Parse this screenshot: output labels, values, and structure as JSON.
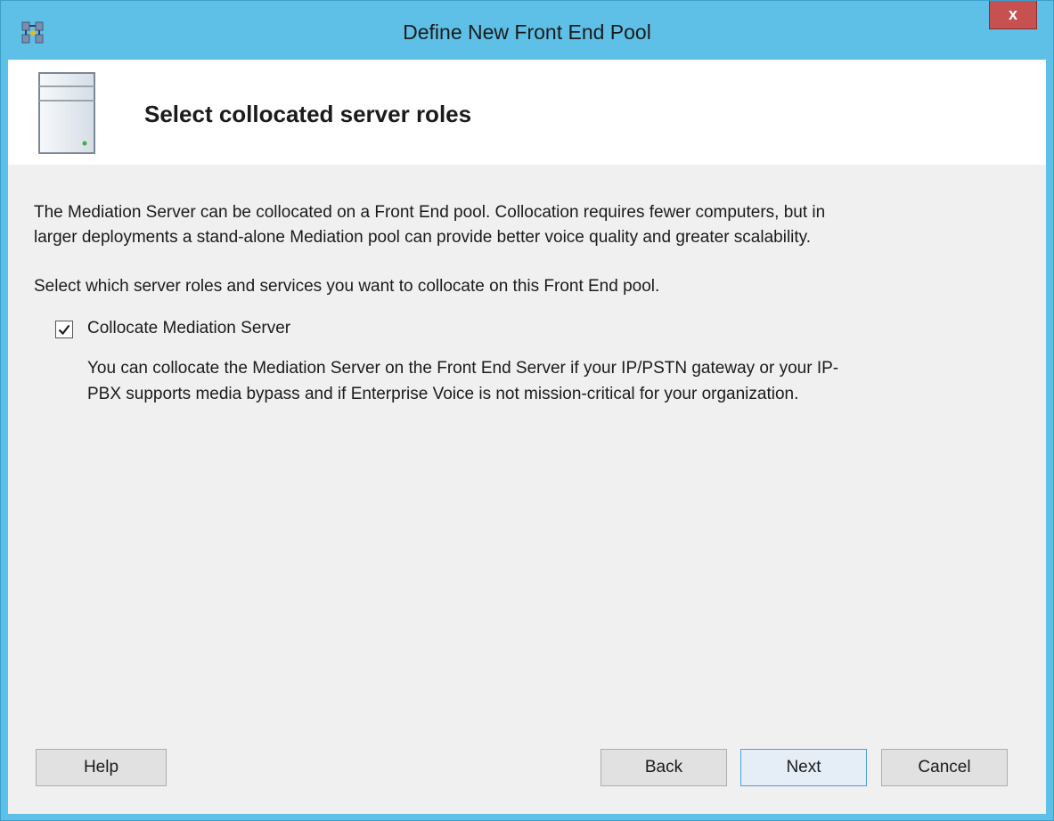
{
  "window": {
    "title": "Define New Front End Pool",
    "close_label": "x"
  },
  "header": {
    "title": "Select collocated server roles"
  },
  "body": {
    "intro_line1": "The Mediation Server can be collocated on a Front End pool. Collocation requires fewer computers, but in",
    "intro_line2": "larger deployments a stand-alone Mediation pool can provide better voice quality and greater scalability.",
    "select_text": "Select which server roles and services you want to collocate on this Front End pool.",
    "checkbox": {
      "label": "Collocate Mediation Server",
      "checked": true
    },
    "description_line1": "You can collocate the Mediation Server on the Front End Server if your IP/PSTN gateway or your IP-",
    "description_line2": "PBX supports media bypass and if Enterprise Voice is not mission-critical for your organization."
  },
  "buttons": {
    "help": "Help",
    "back": "Back",
    "next": "Next",
    "cancel": "Cancel"
  },
  "icons": {
    "app": "topology-builder-icon",
    "header": "server-icon",
    "close": "close-icon",
    "check": "checkmark-icon"
  },
  "colors": {
    "window_frame": "#5ec0e6",
    "close_button": "#c75050",
    "client_background": "#f0f0f0",
    "default_button_border": "#4e9fd6"
  }
}
